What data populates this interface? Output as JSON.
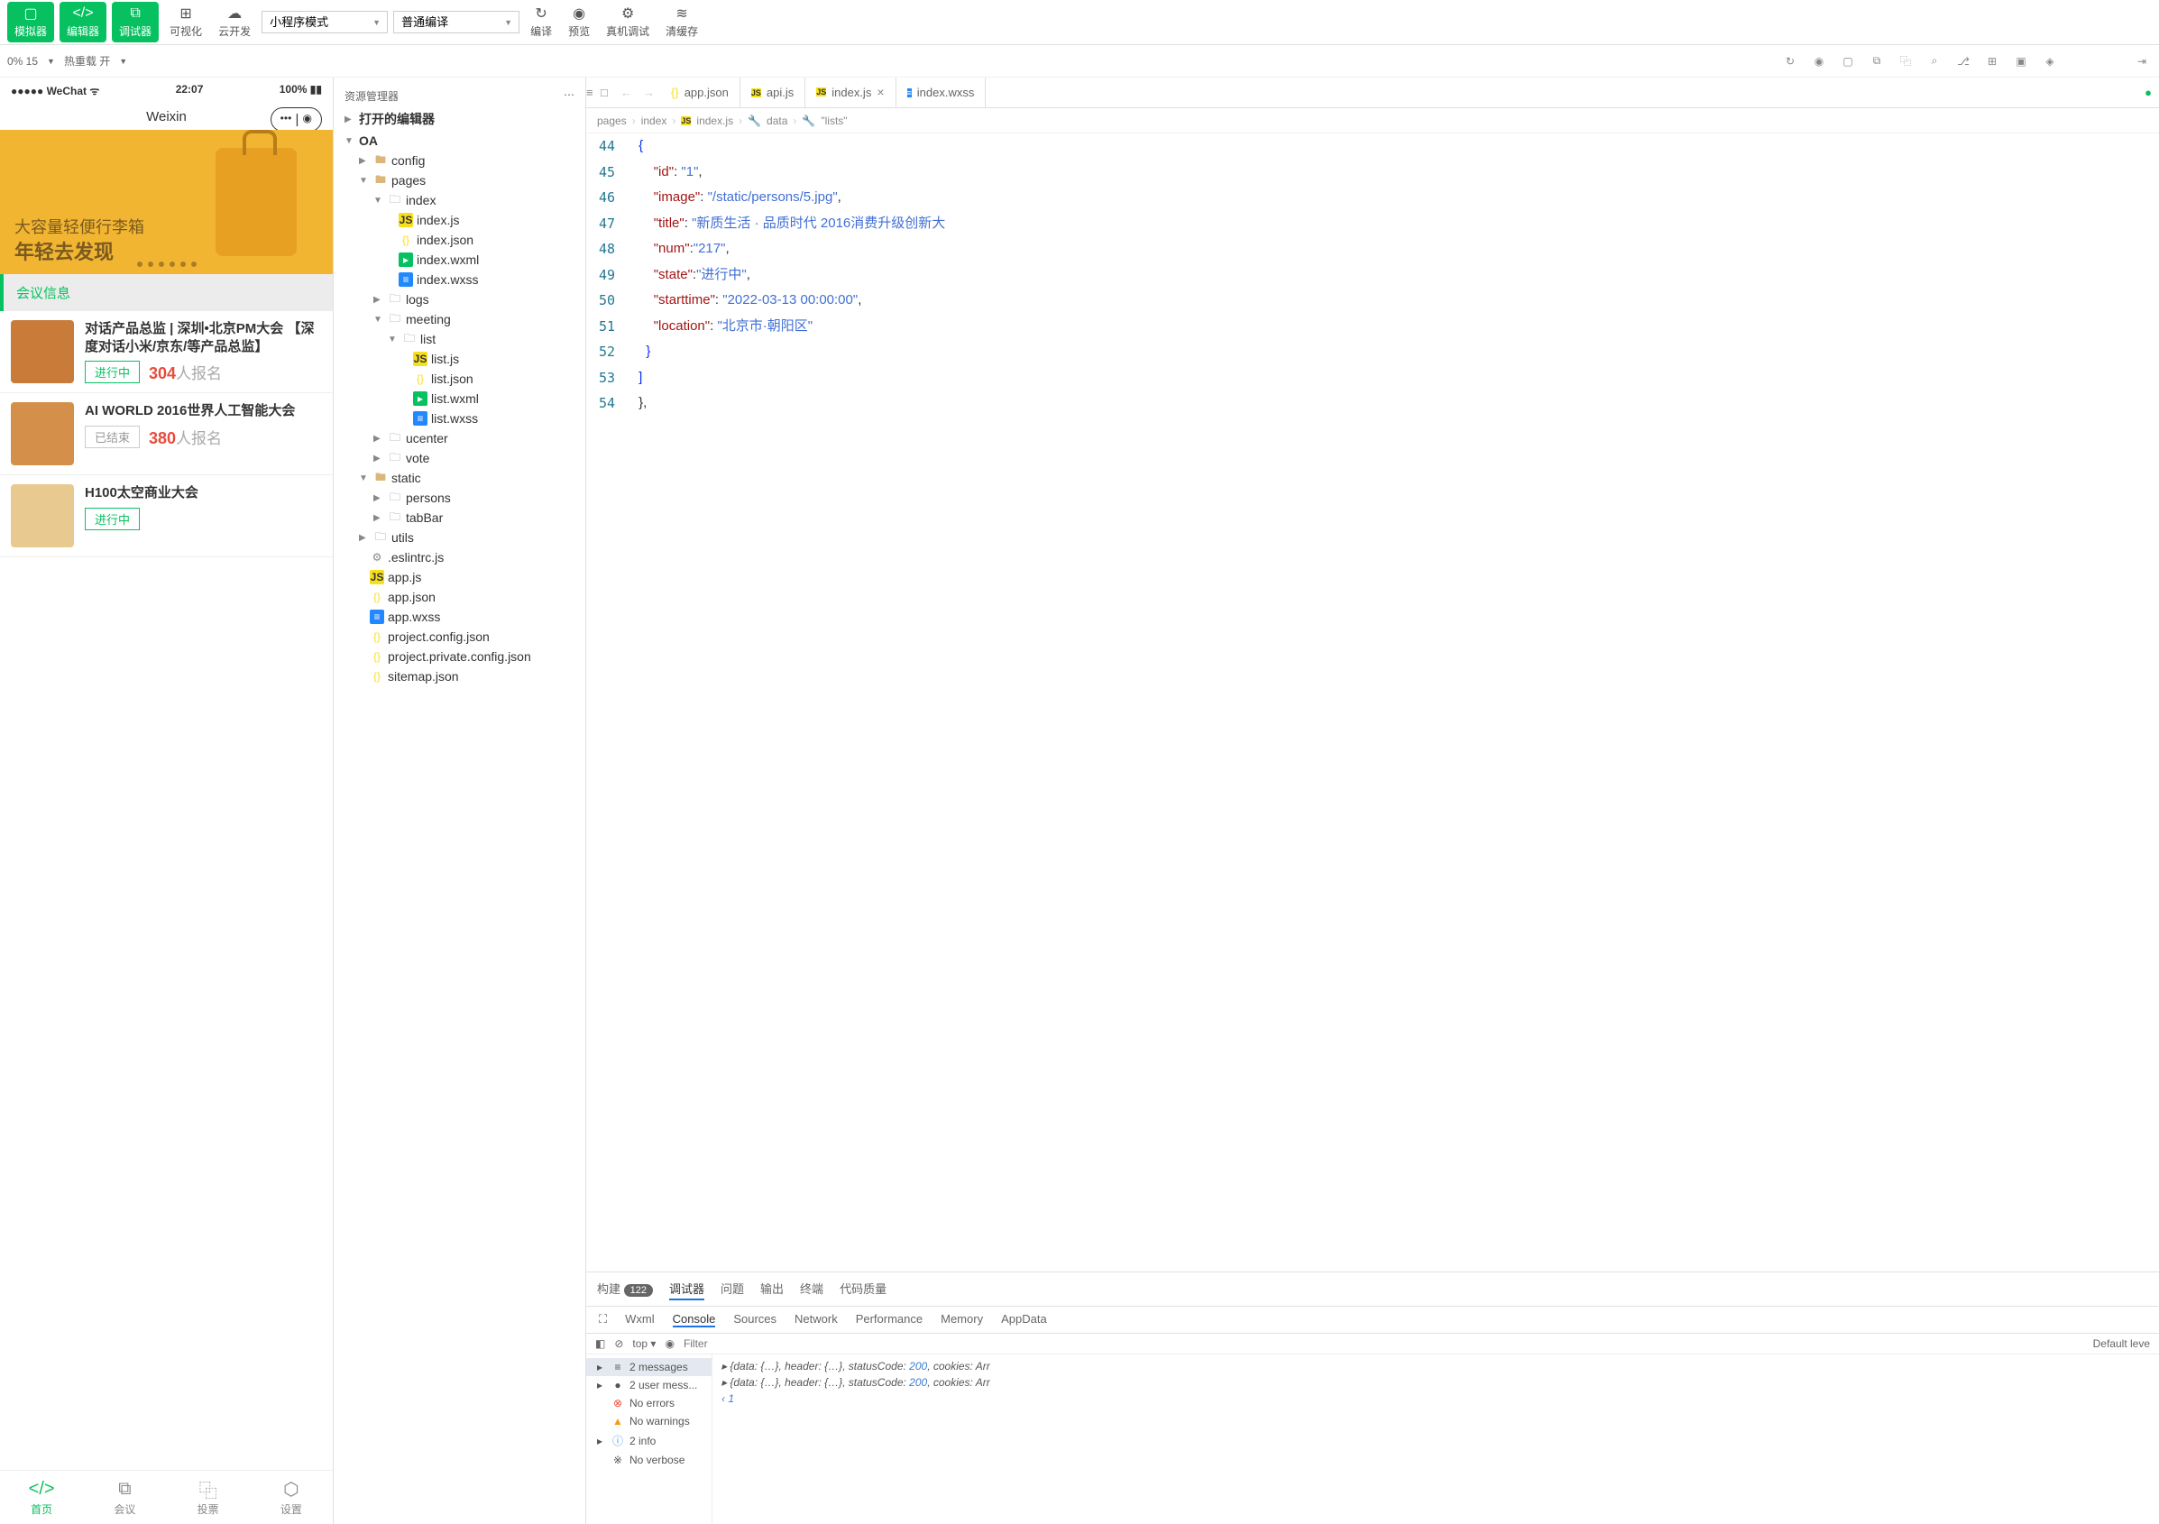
{
  "toolbar": {
    "simulator": "模拟器",
    "editor": "编辑器",
    "debugger": "调试器",
    "visualize": "可视化",
    "cloud": "云开发",
    "mode_select": "小程序模式",
    "compile_select": "普通编译",
    "compile": "编译",
    "preview": "预览",
    "remote_debug": "真机调试",
    "clear_cache": "清缓存"
  },
  "subbar": {
    "zoom": "0% 15",
    "hot_reload": "热重载 开"
  },
  "explorer": {
    "title": "资源管理器",
    "open_editors": "打开的编辑器",
    "root": "OA",
    "tree": {
      "config": "config",
      "pages": "pages",
      "index": "index",
      "index_js": "index.js",
      "index_json": "index.json",
      "index_wxml": "index.wxml",
      "index_wxss": "index.wxss",
      "logs": "logs",
      "meeting": "meeting",
      "list": "list",
      "list_js": "list.js",
      "list_json": "list.json",
      "list_wxml": "list.wxml",
      "list_wxss": "list.wxss",
      "ucenter": "ucenter",
      "vote": "vote",
      "static": "static",
      "persons": "persons",
      "tabBar": "tabBar",
      "utils": "utils",
      "eslintrc": ".eslintrc.js",
      "app_js": "app.js",
      "app_json": "app.json",
      "app_wxss": "app.wxss",
      "proj_config": "project.config.json",
      "proj_private": "project.private.config.json",
      "sitemap": "sitemap.json"
    }
  },
  "tabs": {
    "t0": "app.json",
    "t1": "api.js",
    "t2": "index.js",
    "t3": "index.wxss"
  },
  "breadcrumb": {
    "b0": "pages",
    "b1": "index",
    "b2": "index.js",
    "b3": "data",
    "b4": "\"lists\""
  },
  "code_lines": [
    "44",
    "45",
    "46",
    "47",
    "48",
    "49",
    "50",
    "51",
    "52",
    "53",
    "54"
  ],
  "code": {
    "id_k": "\"id\"",
    "id_v": "\"1\"",
    "image_k": "\"image\"",
    "image_v": "\"/static/persons/5.jpg\"",
    "title_k": "\"title\"",
    "title_v": "\"新质生活 · 品质时代 2016消费升级创新大",
    "num_k": "\"num\"",
    "num_v": "\"217\"",
    "state_k": "\"state\"",
    "state_v": "\"进行中\"",
    "start_k": "\"starttime\"",
    "start_v": "\"2022-03-13 00:00:00\"",
    "loc_k": "\"location\"",
    "loc_v": "\"北京市·朝阳区\""
  },
  "simulator": {
    "carrier": "●●●●● WeChat",
    "time": "22:07",
    "battery": "100%",
    "app_title": "Weixin",
    "banner_line1": "大容量轻便行李箱",
    "banner_line2": "年轻去发现",
    "section": "会议信息",
    "meetings": [
      {
        "title": "对话产品总监 | 深圳•北京PM大会 【深度对话小米/京东/等产品总监】",
        "state": "进行中",
        "state_class": "ongoing",
        "num": "304",
        "signup": "人报名",
        "color": "#c97b3a"
      },
      {
        "title": "AI WORLD 2016世界人工智能大会",
        "state": "已结束",
        "state_class": "ended",
        "num": "380",
        "signup": "人报名",
        "color": "#d4904a"
      },
      {
        "title": "H100太空商业大会",
        "state": "进行中",
        "state_class": "ongoing",
        "num": "",
        "signup": "",
        "color": "#e8c990"
      }
    ],
    "tabbar": {
      "home": "首页",
      "meeting": "会议",
      "vote": "投票",
      "settings": "设置"
    }
  },
  "panel": {
    "build": "构建",
    "build_badge": "122",
    "debugger": "调试器",
    "issues": "问题",
    "output": "输出",
    "terminal": "终端",
    "quality": "代码质量",
    "wxml": "Wxml",
    "console": "Console",
    "sources": "Sources",
    "network": "Network",
    "performance": "Performance",
    "memory": "Memory",
    "appdata": "AppData",
    "top": "top",
    "filter_ph": "Filter",
    "level": "Default leve",
    "side": {
      "messages": "2 messages",
      "user": "2 user mess...",
      "errors": "No errors",
      "warnings": "No warnings",
      "info": "2 info",
      "verbose": "No verbose"
    },
    "log1": "{data: {…}, header: {…}, statusCode: ",
    "log_code": "200",
    "log1b": ", cookies: Arr",
    "log2": "{data: {…}, header: {…}, statusCode: ",
    "log2b": ", cookies: Arr",
    "prompt_val": "1"
  }
}
